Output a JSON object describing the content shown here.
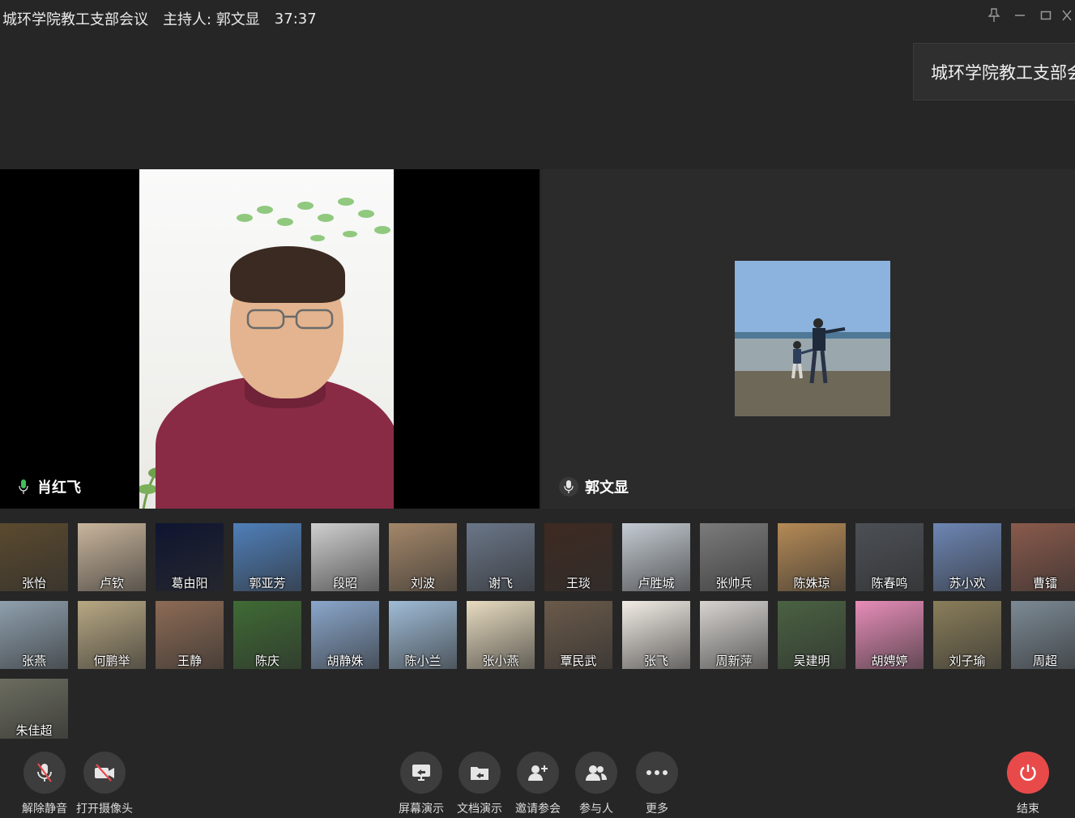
{
  "titlebar": {
    "meeting_title": "城环学院教工支部会议",
    "host_text": "主持人: 郭文显",
    "timer": "37:37"
  },
  "topic_popup": {
    "text": "城环学院教工支部会议"
  },
  "main_videos": {
    "left_name": "肖红飞",
    "right_name": "郭文显"
  },
  "participants": [
    {
      "name": "张怡",
      "bg": "#5b4a2e"
    },
    {
      "name": "卢钦",
      "bg": "#c9b59c"
    },
    {
      "name": "葛由阳",
      "bg": "#0f1530"
    },
    {
      "name": "郭亚芳",
      "bg": "#4f7fb9"
    },
    {
      "name": "段昭",
      "bg": "#cfcfcf"
    },
    {
      "name": "刘波",
      "bg": "#a48769"
    },
    {
      "name": "谢飞",
      "bg": "#6a7688"
    },
    {
      "name": "王琰",
      "bg": "#3e2a22"
    },
    {
      "name": "卢胜城",
      "bg": "#c4cbd2"
    },
    {
      "name": "张帅兵",
      "bg": "#7b7b7b"
    },
    {
      "name": "陈姝琼",
      "bg": "#b58a56"
    },
    {
      "name": "陈春鸣",
      "bg": "#4c5056"
    },
    {
      "name": "苏小欢",
      "bg": "#6d86b4"
    },
    {
      "name": "曹镭",
      "bg": "#8a5a4c"
    },
    {
      "name": "张燕",
      "bg": "#8fa0ae"
    },
    {
      "name": "何鹏举",
      "bg": "#b8a883"
    },
    {
      "name": "王静",
      "bg": "#8d6b55"
    },
    {
      "name": "陈庆",
      "bg": "#3f6b34"
    },
    {
      "name": "胡静姝",
      "bg": "#8aa7cc"
    },
    {
      "name": "陈小兰",
      "bg": "#9fbcd7"
    },
    {
      "name": "张小燕",
      "bg": "#e8dcc0"
    },
    {
      "name": "覃民武",
      "bg": "#6a5a4a"
    },
    {
      "name": "张飞",
      "bg": "#f2ede6"
    },
    {
      "name": "周新萍",
      "bg": "#d7d4d0"
    },
    {
      "name": "吴建明",
      "bg": "#4a6242"
    },
    {
      "name": "胡娉婷",
      "bg": "#e78db8"
    },
    {
      "name": "刘子瑜",
      "bg": "#8a7e5a"
    },
    {
      "name": "周超",
      "bg": "#7c8a95"
    },
    {
      "name": "朱佳超",
      "bg": "#6c6d5f"
    }
  ],
  "toolbar": {
    "unmute": "解除静音",
    "camera": "打开摄像头",
    "screen_share": "屏幕演示",
    "doc_share": "文档演示",
    "invite": "邀请参会",
    "participants": "参与人",
    "more": "更多",
    "end": "结束"
  },
  "colors": {
    "background": "#262626",
    "button": "#3d3d3d",
    "end_button": "#e84a4a",
    "shirt": "#8a2b45"
  }
}
